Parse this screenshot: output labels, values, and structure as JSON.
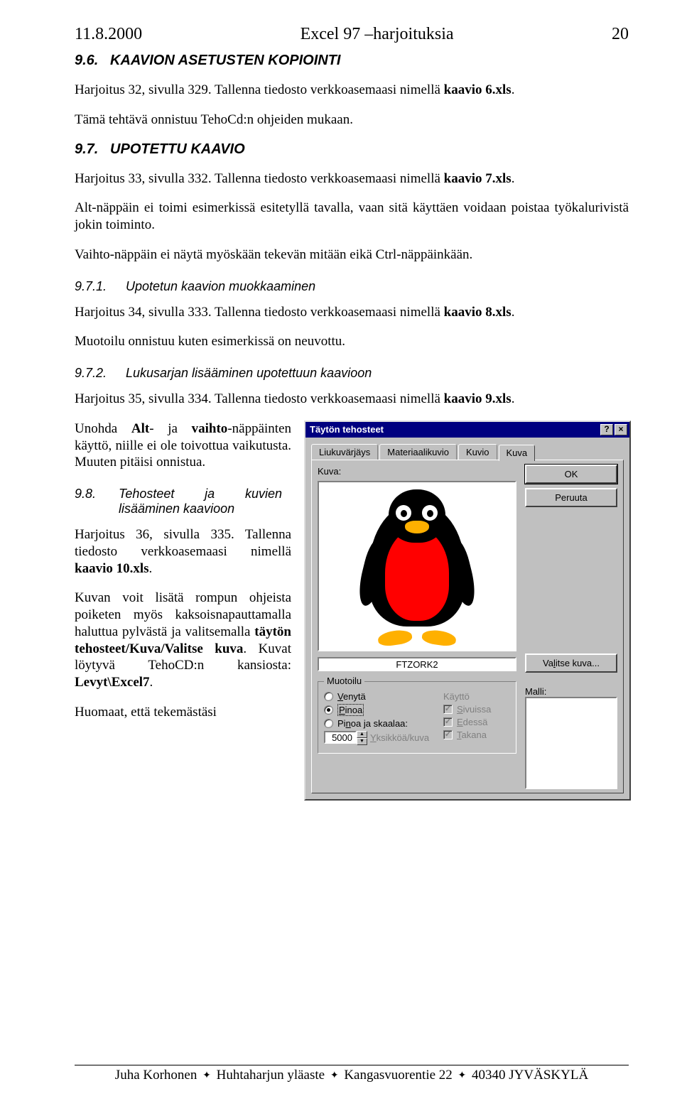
{
  "header": {
    "date": "11.8.2000",
    "title": "Excel 97 –harjoituksia",
    "page": "20"
  },
  "sections": {
    "s96_title": "9.6.   KAAVION ASETUSTEN KOPIOINTI",
    "s96_p1_a": "Harjoitus 32, sivulla 329. Tallenna tiedosto verkkoasemaasi nimellä ",
    "s96_p1_b": "kaavio 6.xls",
    "s96_p1_c": ".",
    "s96_p2": "Tämä tehtävä onnistuu TehoCd:n ohjeiden mukaan.",
    "s97_title": "9.7.   UPOTETTU KAAVIO",
    "s97_p1_a": "Harjoitus 33, sivulla 332. Tallenna tiedosto verkkoasemaasi nimellä ",
    "s97_p1_b": "kaavio 7.xls",
    "s97_p1_c": ".",
    "s97_p2": "Alt-näppäin ei toimi esimerkissä esitetyllä tavalla, vaan sitä käyttäen voidaan poistaa työkalurivistä jokin toiminto.",
    "s97_p3": "Vaihto-näppäin ei näytä myöskään tekevän mitään eikä Ctrl-näppäinkään.",
    "s971_num": "9.7.1.",
    "s971_title": "Upotetun kaavion muokkaaminen",
    "s971_p1_a": "Harjoitus 34, sivulla 333. Tallenna tiedosto verkkoasemaasi nimellä ",
    "s971_p1_b": "kaavio 8.xls",
    "s971_p1_c": ".",
    "s971_p2": "Muotoilu onnistuu kuten esimerkissä on neuvottu.",
    "s972_num": "9.7.2.",
    "s972_title": "Lukusarjan lisääminen upotettuun kaavioon",
    "s972_p1_a": "Harjoitus 35, sivulla 334. Tallenna tiedosto verkkoasemaasi nimellä ",
    "s972_p1_b": "kaavio 9.xls",
    "s972_p1_c": ".",
    "left": {
      "p1_a": "Unohda ",
      "p1_b": "Alt",
      "p1_c": "- ja ",
      "p1_d": "vaihto",
      "p1_e": "-näppäinten käyttö, niille ei ole toivottua vaikutusta. Muuten pitäisi onnistua.",
      "s98_num": "9.8.",
      "s98_title": "Tehosteet ja kuvien lisääminen kaavioon",
      "p2_a": "Harjoitus 36, sivulla 335. Tallenna tiedosto verkkoasemaasi nimellä ",
      "p2_b": "kaavio 10.xls",
      "p2_c": ".",
      "p3_a": "Kuvan voit lisätä rompun ohjeista poiketen myös kaksoisnapauttamalla haluttua pylvästä ja valitsemalla ",
      "p3_b": "täytön tehosteet/Kuva/Valitse kuva",
      "p3_c": ". Kuvat löytyvä TehoCD:n kansiosta: ",
      "p3_d": "Levyt\\Excel7",
      "p3_e": ".",
      "p4": "Huomaat, että tekemästäsi"
    }
  },
  "dialog": {
    "title": "Täytön tehosteet",
    "btn_help": "?",
    "btn_close": "×",
    "tabs": {
      "t1": "Liukuvärjäys",
      "t2": "Materiaalikuvio",
      "t3": "Kuvio",
      "t4": "Kuva"
    },
    "kuva_label": "Kuva:",
    "filename": "FTZORK2",
    "groupbox_title": "Muotoilu",
    "radio_venyta_u": "V",
    "radio_venyta": "enytä",
    "radio_pinoa_u": "P",
    "radio_pinoa": "inoa",
    "radio_skaalaa_a": "Pi",
    "radio_skaalaa_u": "n",
    "radio_skaalaa_b": "oa ja skaalaa:",
    "units_value": "5000",
    "units_u": "Y",
    "units_label": "ksikköä/kuva",
    "check_kaytto": "Käyttö",
    "check_sivuissa_u": "S",
    "check_sivuissa": "ivuissa",
    "check_edessa_u": "E",
    "check_edessa": "dessä",
    "check_takana_u": "T",
    "check_takana": "akana",
    "btn_ok": "OK",
    "btn_peruuta": "Peruuta",
    "btn_valitse_a": "Va",
    "btn_valitse_u": "l",
    "btn_valitse_b": "itse kuva...",
    "malli_label": "Malli:"
  },
  "footer": {
    "a": "Juha Korhonen ",
    "b": " Huhtaharjun yläaste ",
    "c": " Kangasvuorentie 22 ",
    "d": " 40340 JYVÄSKYLÄ",
    "bullet": "✦"
  }
}
